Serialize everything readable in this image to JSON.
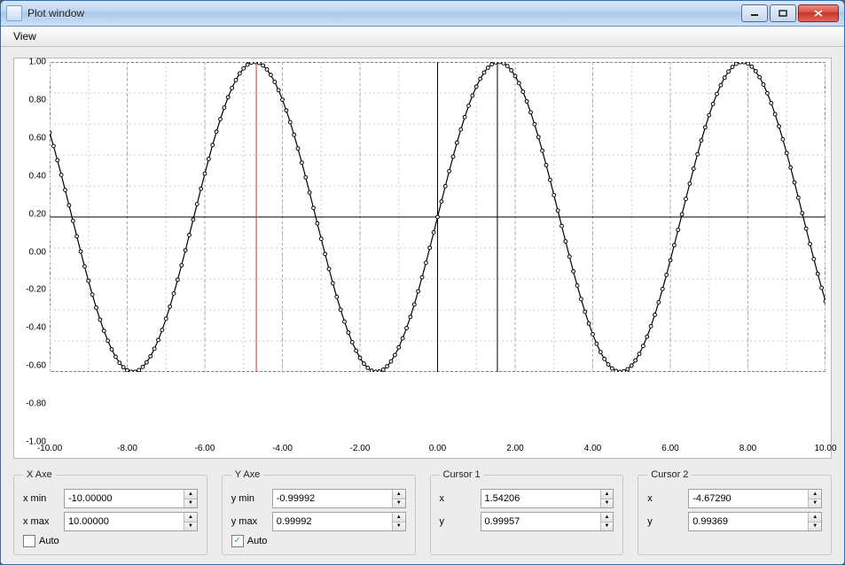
{
  "window": {
    "title": "Plot window"
  },
  "menubar": {
    "view": "View"
  },
  "chart_data": {
    "type": "line",
    "note": "sin(x) sampled at Δx=0.1 over [-10,10], shown with open-circle markers",
    "x_sample_step": 0.1,
    "x": [],
    "y": [],
    "function": "sin",
    "xlim": [
      -10,
      10
    ],
    "ylim": [
      -1,
      1
    ],
    "x_ticks": [
      "-10.00",
      "-8.00",
      "-6.00",
      "-4.00",
      "-2.00",
      "0.00",
      "2.00",
      "4.00",
      "6.00",
      "8.00",
      "10.00"
    ],
    "y_ticks": [
      "-1.00",
      "-0.80",
      "-0.60",
      "-0.40",
      "-0.20",
      "0.00",
      "0.20",
      "0.40",
      "0.60",
      "0.80",
      "1.00"
    ],
    "grid_minor": true,
    "cursor1_x": 1.54206,
    "cursor2_x": -4.6729,
    "cursor2_color": "#b34040"
  },
  "panels": {
    "xaxe": {
      "legend": "X Axe",
      "min_label": "x min",
      "max_label": "x max",
      "min": "-10.00000",
      "max": "10.00000",
      "auto_label": "Auto",
      "auto_checked": false
    },
    "yaxe": {
      "legend": "Y Axe",
      "min_label": "y min",
      "max_label": "y max",
      "min": "-0.99992",
      "max": "0.99992",
      "auto_label": "Auto",
      "auto_checked": true
    },
    "cursor1": {
      "legend": "Cursor 1",
      "x_label": "x",
      "y_label": "y",
      "x": "1.54206",
      "y": "0.99957"
    },
    "cursor2": {
      "legend": "Cursor 2",
      "x_label": "x",
      "y_label": "y",
      "x": "-4.67290",
      "y": "0.99369"
    }
  }
}
